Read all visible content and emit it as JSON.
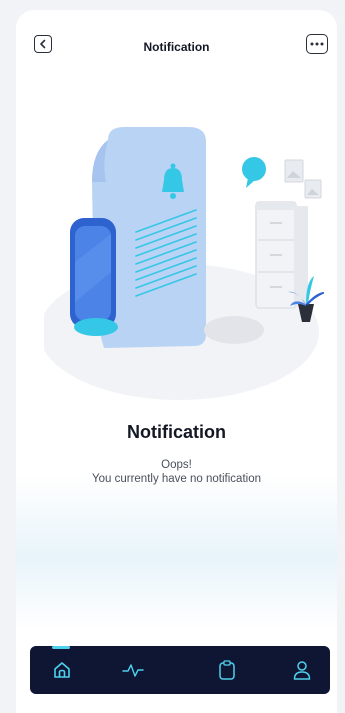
{
  "header": {
    "title": "Notification",
    "back_icon": "chevron-left-icon",
    "more_icon": "more-horizontal-icon"
  },
  "empty_state": {
    "title": "Notification",
    "subtitle_line1": "Oops!",
    "subtitle_line2": "You currently have no notification"
  },
  "bottom_nav": {
    "items": [
      {
        "icon": "home-icon",
        "active": true
      },
      {
        "icon": "activity-icon",
        "active": false
      },
      {
        "icon": "clipboard-icon",
        "active": false
      },
      {
        "icon": "user-icon",
        "active": false
      }
    ],
    "active_color": "#4fd1ee",
    "background": "#0f1633"
  },
  "colors": {
    "accent": "#35c7e6",
    "primary_blue": "#3d73d8",
    "text_dark": "#141824"
  }
}
